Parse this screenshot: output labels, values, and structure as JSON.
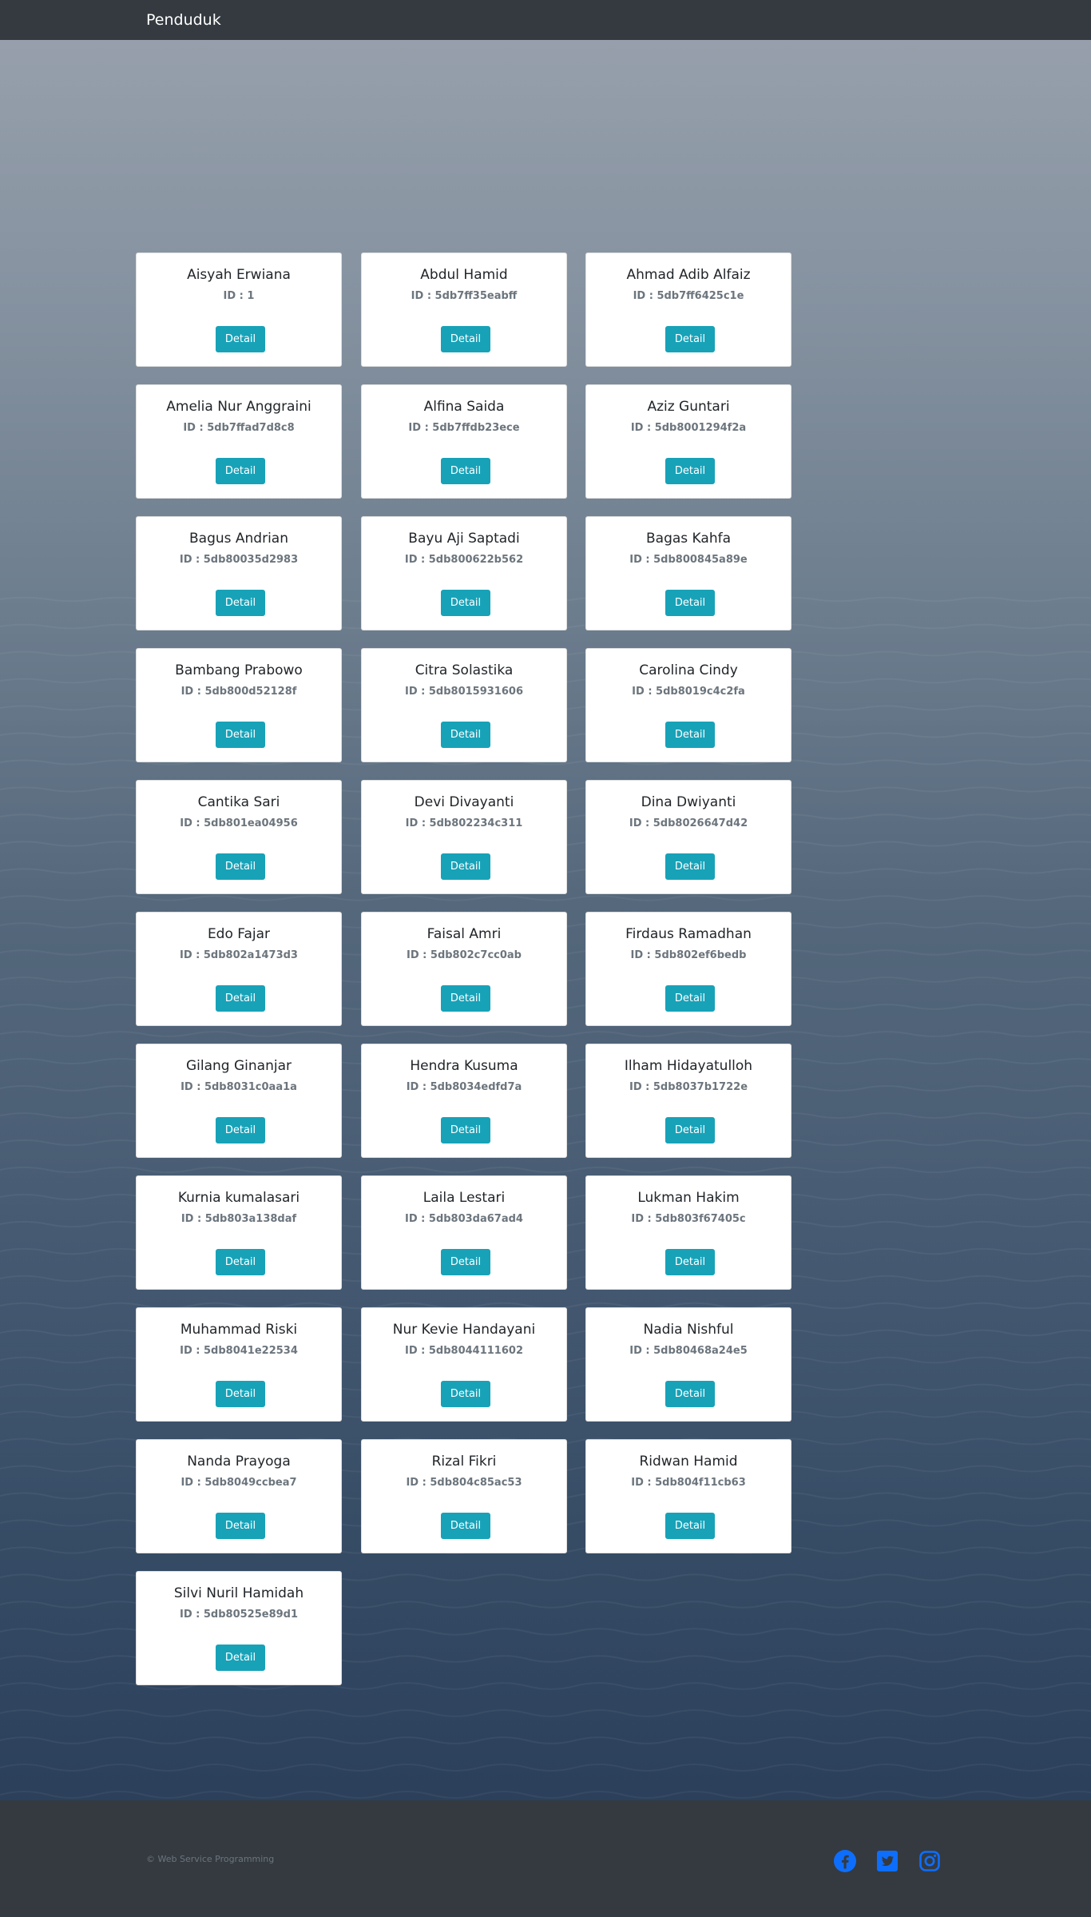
{
  "navbar": {
    "brand": "Penduduk"
  },
  "cards": [
    {
      "name": "Aisyah Erwiana",
      "id": "ID : 1",
      "button": "Detail"
    },
    {
      "name": "Abdul Hamid",
      "id": "ID : 5db7ff35eabff",
      "button": "Detail"
    },
    {
      "name": "Ahmad Adib Alfaiz",
      "id": "ID : 5db7ff6425c1e",
      "button": "Detail"
    },
    {
      "name": "Amelia Nur Anggraini",
      "id": "ID : 5db7ffad7d8c8",
      "button": "Detail"
    },
    {
      "name": "Alfina Saida",
      "id": "ID : 5db7ffdb23ece",
      "button": "Detail"
    },
    {
      "name": "Aziz Guntari",
      "id": "ID : 5db8001294f2a",
      "button": "Detail"
    },
    {
      "name": "Bagus Andrian",
      "id": "ID : 5db80035d2983",
      "button": "Detail"
    },
    {
      "name": "Bayu Aji Saptadi",
      "id": "ID : 5db800622b562",
      "button": "Detail"
    },
    {
      "name": "Bagas Kahfa",
      "id": "ID : 5db800845a89e",
      "button": "Detail"
    },
    {
      "name": "Bambang Prabowo",
      "id": "ID : 5db800d52128f",
      "button": "Detail"
    },
    {
      "name": "Citra Solastika",
      "id": "ID : 5db8015931606",
      "button": "Detail"
    },
    {
      "name": "Carolina Cindy",
      "id": "ID : 5db8019c4c2fa",
      "button": "Detail"
    },
    {
      "name": "Cantika Sari",
      "id": "ID : 5db801ea04956",
      "button": "Detail"
    },
    {
      "name": "Devi Divayanti",
      "id": "ID : 5db802234c311",
      "button": "Detail"
    },
    {
      "name": "Dina Dwiyanti",
      "id": "ID : 5db8026647d42",
      "button": "Detail"
    },
    {
      "name": "Edo Fajar",
      "id": "ID : 5db802a1473d3",
      "button": "Detail"
    },
    {
      "name": "Faisal Amri",
      "id": "ID : 5db802c7cc0ab",
      "button": "Detail"
    },
    {
      "name": "Firdaus Ramadhan",
      "id": "ID : 5db802ef6bedb",
      "button": "Detail"
    },
    {
      "name": "Gilang Ginanjar",
      "id": "ID : 5db8031c0aa1a",
      "button": "Detail"
    },
    {
      "name": "Hendra Kusuma",
      "id": "ID : 5db8034edfd7a",
      "button": "Detail"
    },
    {
      "name": "Ilham Hidayatulloh",
      "id": "ID : 5db8037b1722e",
      "button": "Detail"
    },
    {
      "name": "Kurnia kumalasari",
      "id": "ID : 5db803a138daf",
      "button": "Detail"
    },
    {
      "name": "Laila Lestari",
      "id": "ID : 5db803da67ad4",
      "button": "Detail"
    },
    {
      "name": "Lukman Hakim",
      "id": "ID : 5db803f67405c",
      "button": "Detail"
    },
    {
      "name": "Muhammad Riski",
      "id": "ID : 5db8041e22534",
      "button": "Detail"
    },
    {
      "name": "Nur Kevie Handayani",
      "id": "ID : 5db8044111602",
      "button": "Detail"
    },
    {
      "name": "Nadia Nishful",
      "id": "ID : 5db80468a24e5",
      "button": "Detail"
    },
    {
      "name": "Nanda Prayoga",
      "id": "ID : 5db8049ccbea7",
      "button": "Detail"
    },
    {
      "name": "Rizal Fikri",
      "id": "ID : 5db804c85ac53",
      "button": "Detail"
    },
    {
      "name": "Ridwan Hamid",
      "id": "ID : 5db804f11cb63",
      "button": "Detail"
    },
    {
      "name": "Silvi Nuril Hamidah",
      "id": "ID : 5db80525e89d1",
      "button": "Detail"
    }
  ],
  "footer": {
    "copyright": "© Web Service Programming",
    "social_icons": [
      "facebook-icon",
      "twitter-icon",
      "instagram-icon"
    ],
    "social_color": "#0d6efd"
  },
  "colors": {
    "navbar": "#343a40",
    "button": "#17a2b8",
    "card": "#ffffff"
  }
}
